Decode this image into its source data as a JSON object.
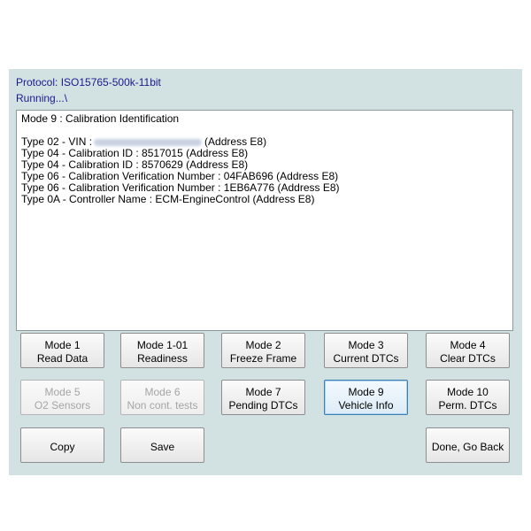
{
  "header": {
    "protocol": "Protocol: ISO15765-500k-11bit",
    "status": "Running...\\"
  },
  "output": {
    "title": "Mode 9 : Calibration Identification",
    "vin_prefix": "Type 02 - VIN :",
    "vin_suffix": "(Address E8)",
    "lines": [
      "Type 04 - Calibration ID : 8517015 (Address E8)",
      "Type 04 - Calibration ID : 8570629 (Address E8)",
      "Type 06 - Calibration Verification Number : 04FAB696 (Address E8)",
      "Type 06 - Calibration Verification Number : 1EB6A776 (Address E8)",
      "Type 0A - Controller Name : ECM-EngineControl (Address E8)"
    ]
  },
  "buttons": {
    "mode1": {
      "line1": "Mode 1",
      "line2": "Read Data"
    },
    "mode1_01": {
      "line1": "Mode 1-01",
      "line2": "Readiness"
    },
    "mode2": {
      "line1": "Mode 2",
      "line2": "Freeze Frame"
    },
    "mode3": {
      "line1": "Mode 3",
      "line2": "Current DTCs"
    },
    "mode4": {
      "line1": "Mode 4",
      "line2": "Clear DTCs"
    },
    "mode5": {
      "line1": "Mode 5",
      "line2": "O2 Sensors"
    },
    "mode6": {
      "line1": "Mode 6",
      "line2": "Non cont. tests"
    },
    "mode7": {
      "line1": "Mode 7",
      "line2": "Pending DTCs"
    },
    "mode9": {
      "line1": "Mode 9",
      "line2": "Vehicle Info"
    },
    "mode10": {
      "line1": "Mode 10",
      "line2": "Perm. DTCs"
    },
    "copy": "Copy",
    "save": "Save",
    "done": "Done, Go Back"
  }
}
